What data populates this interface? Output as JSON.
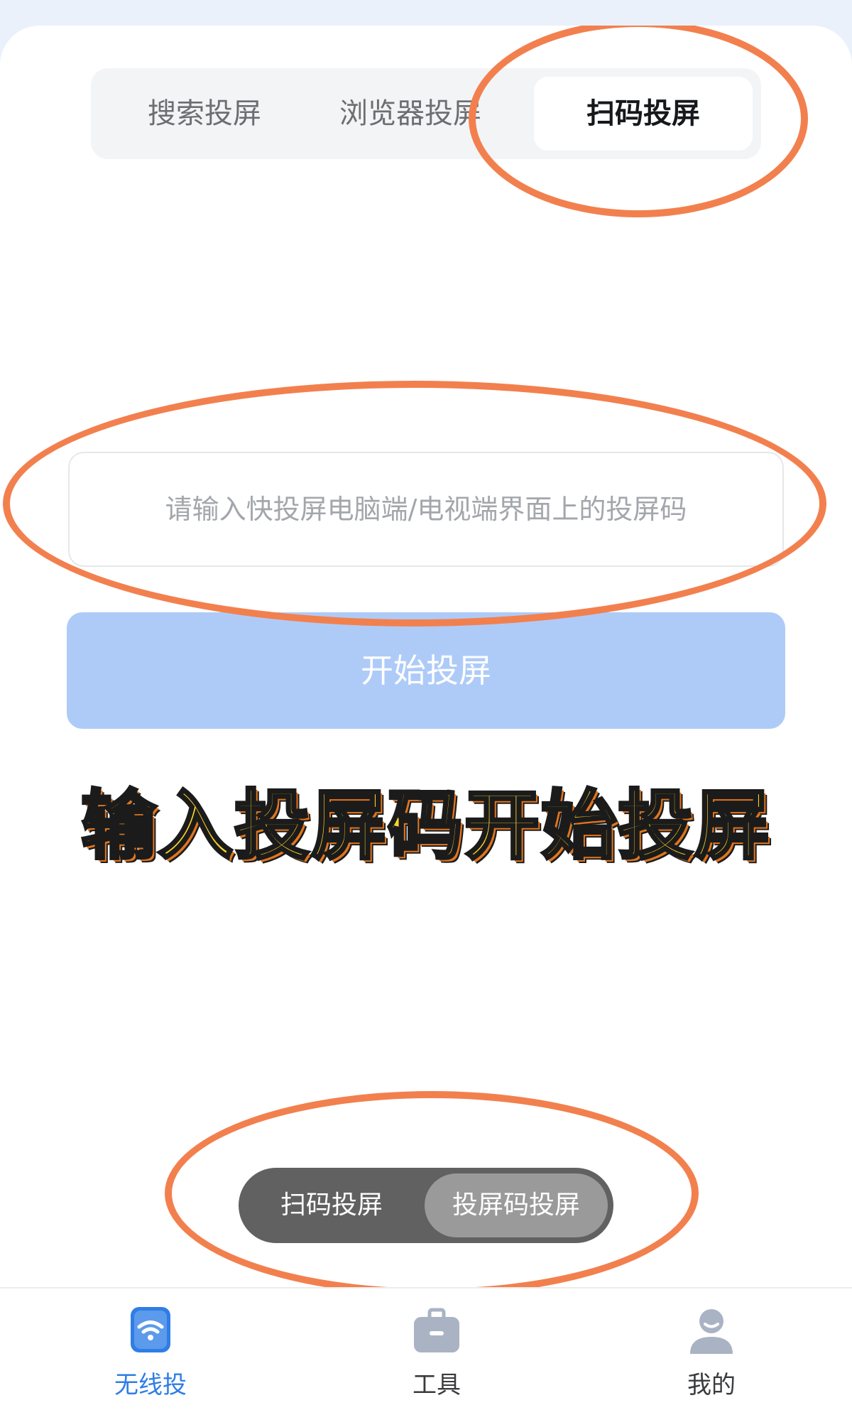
{
  "tabs": {
    "items": [
      {
        "label": "搜索投屏"
      },
      {
        "label": "浏览器投屏"
      },
      {
        "label": "扫码投屏"
      }
    ],
    "active": "扫码投屏"
  },
  "code_input": {
    "placeholder": "请输入快投屏电脑端/电视端界面上的投屏码",
    "value": ""
  },
  "start_button": {
    "label": "开始投屏"
  },
  "overlay": {
    "headline": "输入投屏码开始投屏"
  },
  "mode_toggle": {
    "options": [
      {
        "label": "扫码投屏"
      },
      {
        "label": "投屏码投屏"
      }
    ],
    "selected": "投屏码投屏"
  },
  "bottom_nav": {
    "items": [
      {
        "label": "无线投",
        "icon": "wifi-cast-icon"
      },
      {
        "label": "工具",
        "icon": "toolbox-icon"
      },
      {
        "label": "我的",
        "icon": "user-icon"
      }
    ],
    "active": "无线投"
  },
  "colors": {
    "accent": "#2f7ee6",
    "button_disabled": "#aecbf8",
    "annotation": "#f2804e",
    "headline_fill": "#ffd527"
  }
}
